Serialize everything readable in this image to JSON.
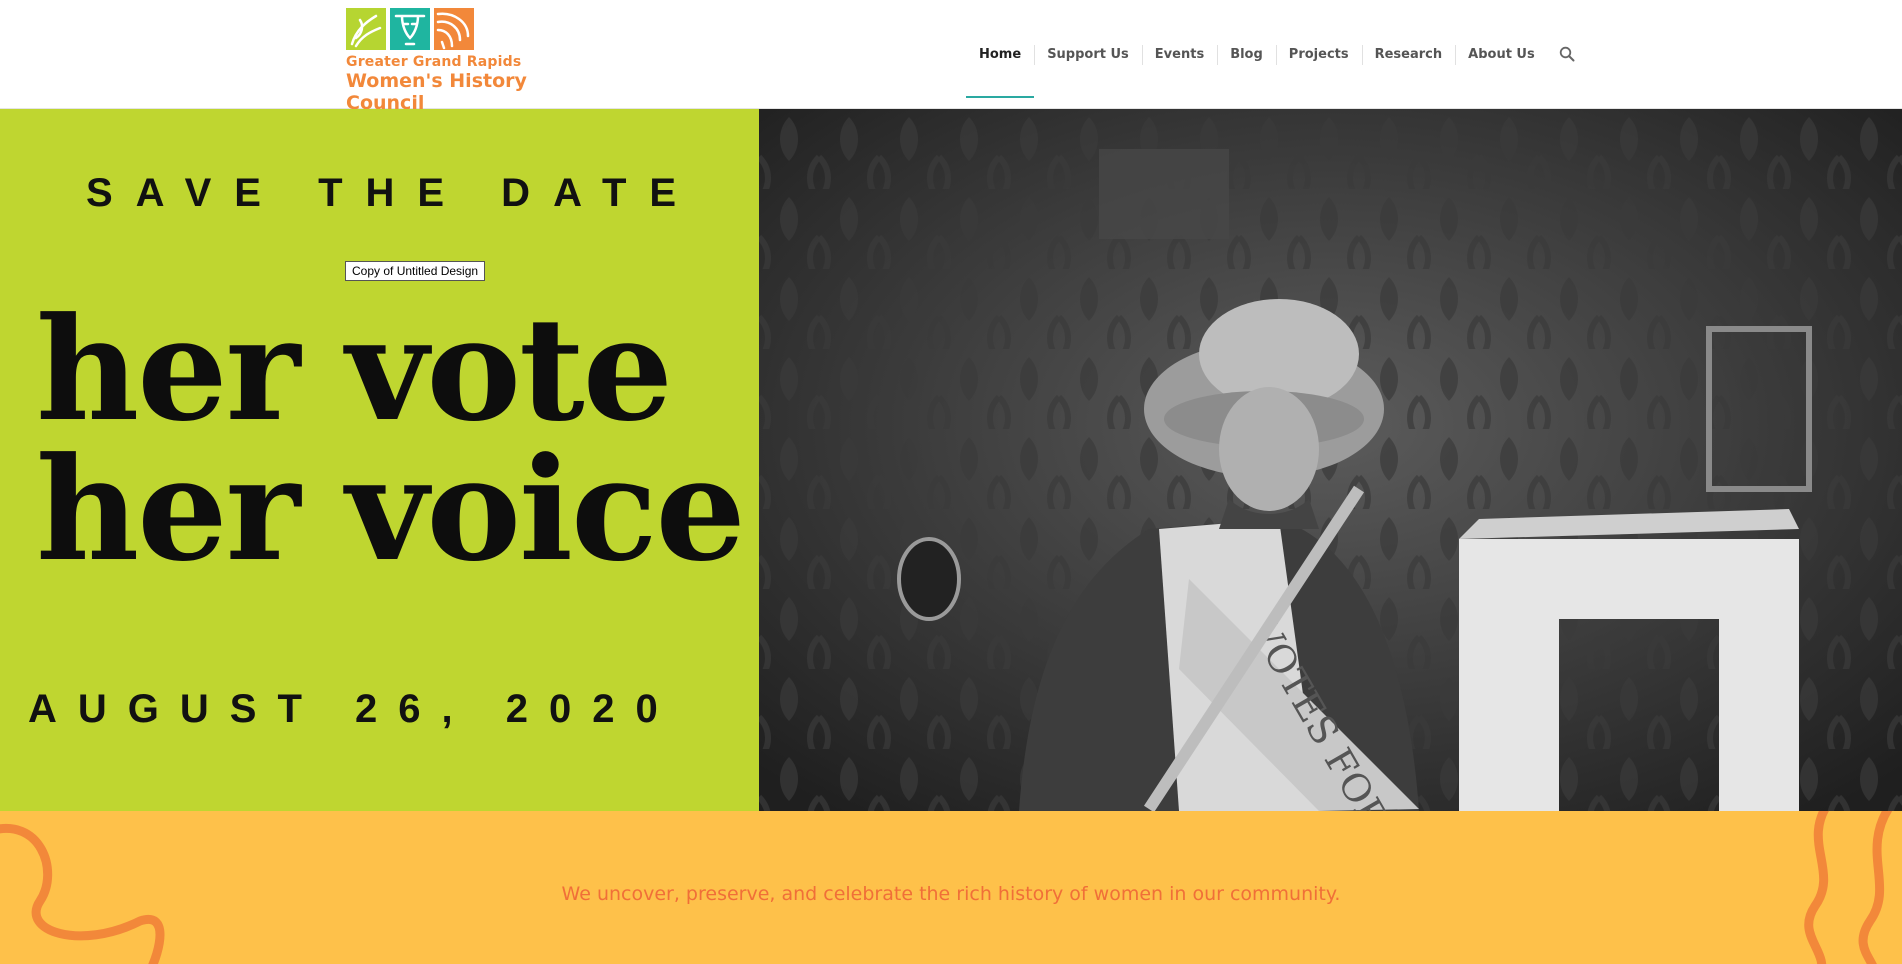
{
  "logo": {
    "line1": "Greater Grand Rapids",
    "line2": "Women's History Council",
    "colors": [
      "#b6d531",
      "#1fb5a0",
      "#f2883a"
    ]
  },
  "nav": {
    "items": [
      {
        "label": "Home",
        "active": true
      },
      {
        "label": "Support Us"
      },
      {
        "label": "Events"
      },
      {
        "label": "Blog"
      },
      {
        "label": "Projects"
      },
      {
        "label": "Research"
      },
      {
        "label": "About Us"
      }
    ],
    "search_icon": "search-icon"
  },
  "hero": {
    "save_the_date": "SAVE THE DATE",
    "tooltip": "Copy of Untitled Design",
    "headline_line1": "her vote",
    "headline_line2": "her voice",
    "date": "AUGUST 26, 2020",
    "banner_text": "VOTES FOR WOMEN",
    "background_color": "#bfd630"
  },
  "band": {
    "tagline": "We uncover, preserve, and celebrate the rich history of women in our community.",
    "background_color": "#fec14a",
    "text_color": "#f06f38"
  }
}
